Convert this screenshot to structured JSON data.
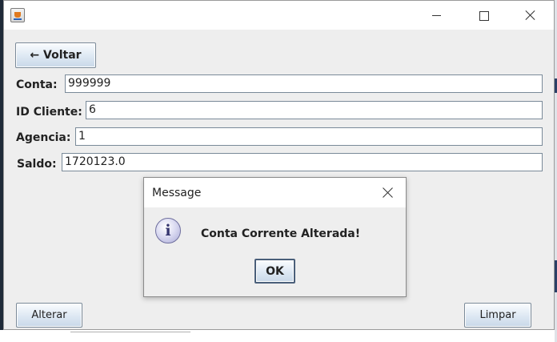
{
  "window": {
    "title": "",
    "controls": [
      "minimize-icon",
      "maximize-icon",
      "close-icon"
    ]
  },
  "toolbar": {
    "back_label": "← Voltar"
  },
  "form": {
    "conta": {
      "label": "Conta:",
      "value": "999999"
    },
    "id_cliente": {
      "label": "ID Cliente:",
      "value": "6"
    },
    "agencia": {
      "label": "Agencia:",
      "value": "1"
    },
    "saldo": {
      "label": "Saldo:",
      "value": "1720123.0"
    }
  },
  "actions": {
    "alterar_label": "Alterar",
    "limpar_label": "Limpar"
  },
  "dialog": {
    "title": "Message",
    "icon": "info-icon",
    "icon_glyph": "i",
    "message": "Conta Corrente Alterada!",
    "ok_label": "OK"
  },
  "colors": {
    "window_bg": "#eeeeee",
    "button_gradient_top": "#fafcfe",
    "button_gradient_bottom": "#c9d8e8",
    "info_icon": "#a9a9d6"
  }
}
